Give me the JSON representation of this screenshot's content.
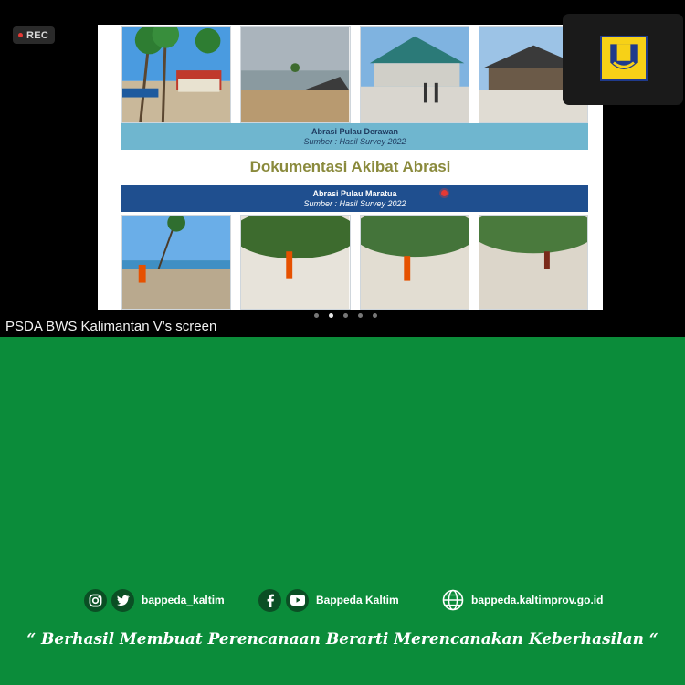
{
  "recording": {
    "label": "REC"
  },
  "slide": {
    "top_caption": {
      "title": "Abrasi Pulau Derawan",
      "source": "Sumber : Hasil Survey 2022"
    },
    "heading": "Dokumentasi Akibat Abrasi",
    "bottom_caption": {
      "title": "Abrasi Pulau Maratua",
      "source": "Sumber : Hasil Survey 2022"
    }
  },
  "pager": {
    "total": 5,
    "active_index": 1
  },
  "screen_share": {
    "label": "PSDA BWS Kalimantan V's screen"
  },
  "footer": {
    "instagram_twitter_handle": "bappeda_kaltim",
    "facebook_youtube_name": "Bappeda Kaltim",
    "website": "bappeda.kaltimprov.go.id",
    "tagline": "“ Berhasil  Membuat Perencanaan Berarti Merencanakan Keberhasilan “"
  },
  "colors": {
    "footer_green": "#0b8c3a",
    "caption_light": "#6fb6cf",
    "caption_dark": "#1f4f8f",
    "heading_olive": "#8a8a3c",
    "logo_yellow": "#f7d117"
  }
}
